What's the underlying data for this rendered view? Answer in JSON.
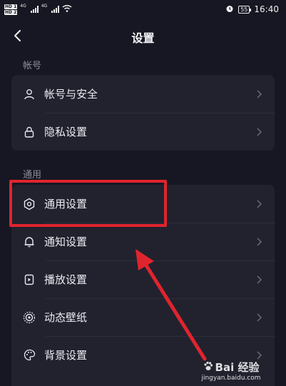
{
  "status_bar": {
    "hd1": "HD 1",
    "hd2": "HD 2",
    "net1": "4G",
    "net2": "4G",
    "battery": "55",
    "time": "16:40"
  },
  "header": {
    "title": "设置"
  },
  "sections": [
    {
      "label": "帐号",
      "items": [
        {
          "label": "帐号与安全",
          "icon": "user-icon"
        },
        {
          "label": "隐私设置",
          "icon": "lock-icon"
        }
      ]
    },
    {
      "label": "通用",
      "items": [
        {
          "label": "通用设置",
          "icon": "gear-icon"
        },
        {
          "label": "通知设置",
          "icon": "bell-icon"
        },
        {
          "label": "播放设置",
          "icon": "play-icon"
        },
        {
          "label": "动态壁纸",
          "icon": "wallpaper-icon"
        },
        {
          "label": "背景设置",
          "icon": "palette-icon"
        }
      ]
    }
  ],
  "colors": {
    "background": "#161722",
    "card": "#21222e",
    "highlight": "#e0242e"
  },
  "watermark": {
    "brand": "Bai 经验",
    "url": "jingyan.baidu.com"
  }
}
